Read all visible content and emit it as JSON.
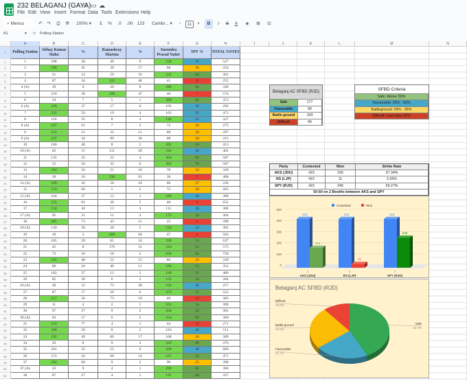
{
  "app": {
    "title": "232 BELAGANJ (GAYA)",
    "menu": [
      "File",
      "Edit",
      "View",
      "Insert",
      "Format",
      "Data",
      "Tools",
      "Extensions",
      "Help"
    ],
    "toolbar": {
      "search": "Menus",
      "zoom": "100%",
      "currency": "£",
      "percent": "%",
      "dec_less": ".0",
      "dec_more": ".00",
      "format_123": "123",
      "font": "Cambr...",
      "font_size": "11",
      "minus": "−",
      "plus": "+",
      "bold": "B",
      "italic": "I",
      "strike": "S",
      "text_color": "A"
    },
    "name_box": "A1",
    "fx": "fx",
    "formula": "Polling Station"
  },
  "columns": [
    "A",
    "B",
    "C",
    "D",
    "E",
    "F",
    "G",
    "H",
    "I",
    "J",
    "K",
    "L",
    "M",
    "N"
  ],
  "table": {
    "headers": [
      "Polling Station",
      "Abhay Kumar Sinha",
      "%",
      "Ramashray Sharma",
      "%",
      "Surendra Prasad Yadav",
      "SPY %",
      "TOTAL VOTES"
    ],
    "rows": [
      [
        "1",
        198,
        38,
        49,
        9,
        228,
        43,
        527
      ],
      [
        "2",
        100,
        45,
        38,
        17,
        68,
        30,
        224
      ],
      [
        "3",
        51,
        14,
        59,
        16,
        232,
        64,
        361
      ],
      [
        "4",
        87,
        34,
        122,
        48,
        41,
        16,
        255
      ],
      [
        "4 (A)",
        19,
        6,
        26,
        8,
        286,
        84,
        340
      ],
      [
        "5",
        216,
        38,
        268,
        47,
        40,
        7,
        574
      ],
      [
        "6",
        24,
        7,
        5,
        1,
        289,
        82,
        353
      ],
      [
        "6 (A)",
        109,
        37,
        17,
        6,
        105,
        36,
        292
      ],
      [
        "7",
        235,
        50,
        19,
        4,
        163,
        35,
        471
      ],
      [
        "8",
        116,
        35,
        8,
        2,
        146,
        45,
        327
      ],
      [
        "8 (A)",
        167,
        61,
        7,
        3,
        72,
        26,
        275
      ],
      [
        "9",
        152,
        51,
        32,
        11,
        89,
        30,
        297
      ],
      [
        "9 (A)",
        107,
        34,
        89,
        28,
        88,
        28,
        315
      ],
      [
        "10",
        166,
        40,
        8,
        2,
        205,
        50,
        413
      ],
      [
        "10 (A)",
        62,
        15,
        111,
        28,
        192,
        48,
        401
      ],
      [
        "11",
        135,
        23,
        22,
        4,
        364,
        62,
        587
      ],
      [
        "12",
        52,
        10,
        32,
        6,
        395,
        78,
        507
      ],
      [
        "13",
        184,
        56,
        51,
        16,
        78,
        24,
        329
      ],
      [
        "14",
        39,
        10,
        330,
        81,
        30,
        7,
        408
      ],
      [
        "14 (A)",
        106,
        43,
        58,
        24,
        66,
        27,
        246
      ],
      [
        "15",
        174,
        66,
        5,
        2,
        73,
        28,
        265
      ],
      [
        "15 (A)",
        104,
        27,
        13,
        3,
        186,
        48,
        388
      ],
      [
        "16",
        525,
        81,
        30,
        5,
        40,
        6,
        652
      ],
      [
        "17",
        134,
        44,
        13,
        4,
        115,
        38,
        306
      ],
      [
        "17 (A)",
        95,
        31,
        11,
        4,
        175,
        58,
        304
      ],
      [
        "18",
        285,
        73,
        43,
        11,
        25,
        6,
        390
      ],
      [
        "18 (A)",
        149,
        39,
        20,
        5,
        156,
        41,
        381
      ],
      [
        "19",
        10,
        2,
        488,
        84,
        47,
        8,
        583
      ],
      [
        "20",
        185,
        29,
        65,
        10,
        338,
        53,
        637
      ],
      [
        "21",
        45,
        8,
        176,
        31,
        316,
        55,
        575
      ],
      [
        "22",
        73,
        10,
        18,
        2,
        636,
        84,
        758
      ],
      [
        "23",
        162,
        48,
        52,
        15,
        89,
        26,
        339
      ],
      [
        "24",
        86,
        24,
        40,
        11,
        186,
        53,
        352
      ],
      [
        "25",
        182,
        37,
        12,
        2,
        249,
        51,
        486
      ],
      [
        "26",
        85,
        30,
        6,
        2,
        152,
        54,
        284
      ],
      [
        "26 (A)",
        30,
        12,
        72,
        28,
        102,
        40,
        257
      ],
      [
        "27",
        87,
        17,
        29,
        6,
        373,
        71,
        523
      ],
      [
        "28",
        217,
        56,
        73,
        19,
        69,
        18,
        385
      ],
      [
        "29",
        11,
        4,
        2,
        1,
        161,
        54,
        300
      ],
      [
        "30",
        97,
        27,
        9,
        2,
        204,
        56,
        365
      ],
      [
        "30 (A)",
        63,
        17,
        6,
        2,
        254,
        69,
        369
      ],
      [
        "31",
        210,
        77,
        4,
        1,
        44,
        16,
        271
      ],
      [
        "32",
        300,
        59,
        8,
        2,
        216,
        42,
        511
      ],
      [
        "33",
        192,
        49,
        66,
        17,
        108,
        28,
        389
      ],
      [
        "34",
        29,
        8,
        9,
        2,
        329,
        88,
        376
      ],
      [
        "35",
        201,
        33,
        55,
        9,
        290,
        48,
        609
      ],
      [
        "36",
        113,
        24,
        68,
        14,
        247,
        52,
        471
      ],
      [
        "37",
        264,
        66,
        9,
        2,
        99,
        25,
        398
      ],
      [
        "37 (A)",
        32,
        9,
        4,
        1,
        296,
        82,
        360
      ],
      [
        "38",
        87,
        27,
        4,
        1,
        195,
        60,
        327
      ]
    ]
  },
  "colors": {
    "winner": "#77d94f",
    "safe": "#6aa84f",
    "favourable": "#46a8c8",
    "battle": "#ffc000",
    "difficult": "#e94235",
    "header": "#c9daf8"
  },
  "sfbd": {
    "title": "Belaganj AC  SFBD (RJD)",
    "rows": [
      {
        "label": "Safe",
        "value": 177,
        "color": "#93c47d"
      },
      {
        "label": "Favourable",
        "value": 90,
        "color": "#46a8c8"
      },
      {
        "label": "Battle ground",
        "value": 103,
        "color": "#ffd966"
      },
      {
        "label": "Difficult",
        "value": 45,
        "color": "#cc4125"
      }
    ]
  },
  "criteria": {
    "title": "SFBD Criteria",
    "rows": [
      {
        "label": "Safe: Above 50%",
        "color": "#93c47d"
      },
      {
        "label": "Favourable: 35% - 50%",
        "color": "#46a8c8"
      },
      {
        "label": "Battleground: 20% - 35%",
        "color": "#ffd966"
      },
      {
        "label": "Difficult: Less than 20%",
        "color": "#cc4125"
      }
    ]
  },
  "party_table": {
    "headers": [
      "Party",
      "Contested",
      "Won",
      "Strike Rate"
    ],
    "rows": [
      [
        "AKS (JDU)",
        "415",
        "155",
        "37.34%"
      ],
      [
        "RS (LJP)",
        "415",
        "11",
        "2.65%"
      ],
      [
        "SPY (RJD)",
        "415",
        "246",
        "59.27%"
      ]
    ],
    "note": "50-50 on 2 Booths between AKS and SPY"
  },
  "chart_data": [
    {
      "type": "bar",
      "title": "",
      "categories": [
        "AKS (JDU)",
        "RS (LJP)",
        "SPY (RJD)"
      ],
      "series": [
        {
          "name": "Contested",
          "values": [
            415,
            415,
            415
          ],
          "color": "#4285f4"
        },
        {
          "name": "Won",
          "values": [
            155,
            11,
            246
          ],
          "colors": [
            "#6aa84f",
            "#ea4335",
            "#0b8a0b"
          ]
        }
      ],
      "yticks": [
        0,
        100,
        200,
        300,
        400,
        500
      ],
      "ylim": [
        0,
        500
      ],
      "legend": "top"
    },
    {
      "type": "pie",
      "title": "Belaganj AC SFBD (RJD)",
      "slices": [
        {
          "label": "Safe",
          "value": 42.7,
          "pct": "42.7%",
          "color": "#34a853"
        },
        {
          "label": "Favourable",
          "value": 21.7,
          "pct": "21.7%",
          "color": "#46a8c8"
        },
        {
          "label": "Battle ground",
          "value": 24.8,
          "pct": "24.8%",
          "color": "#fbbc04"
        },
        {
          "label": "Difficult",
          "value": 10.8,
          "pct": "10.8%",
          "color": "#ea4335"
        }
      ]
    }
  ]
}
